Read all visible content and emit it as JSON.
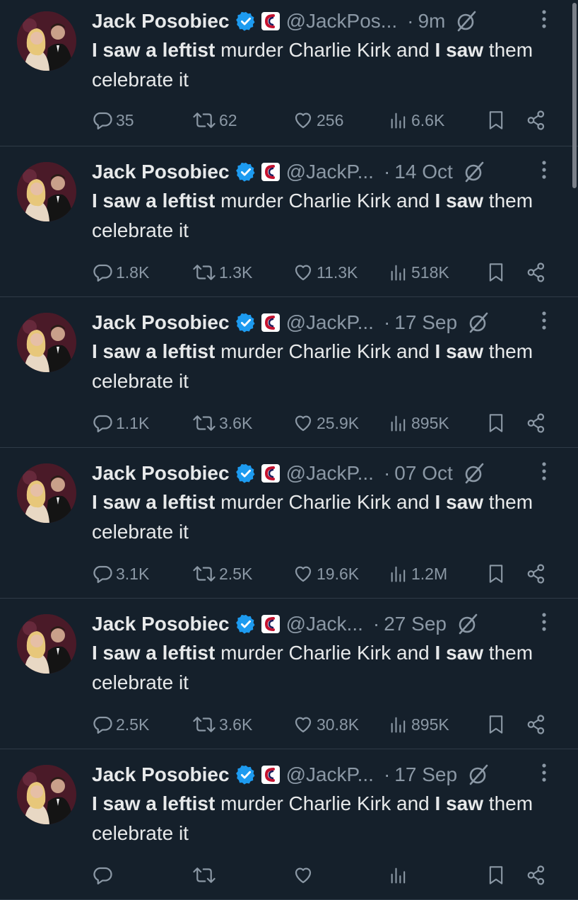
{
  "author": {
    "name": "Jack Posobiec"
  },
  "tweets": [
    {
      "handle": "@JackPos...",
      "time": "9m",
      "text_bold1": "I saw a leftist",
      "text_mid": " murder Charlie Kirk and ",
      "text_bold2": "I saw",
      "text_end": " them celebrate it",
      "replies": "35",
      "reposts": "62",
      "likes": "256",
      "views": "6.6K"
    },
    {
      "handle": "@JackP...",
      "time": "14 Oct",
      "text_bold1": "I saw a leftist",
      "text_mid": " murder Charlie Kirk and ",
      "text_bold2": "I saw",
      "text_end": " them celebrate it",
      "replies": "1.8K",
      "reposts": "1.3K",
      "likes": "11.3K",
      "views": "518K"
    },
    {
      "handle": "@JackP...",
      "time": "17 Sep",
      "text_bold1": "I saw a leftist",
      "text_mid": " murder Charlie Kirk and ",
      "text_bold2": "I saw",
      "text_end": " them celebrate it",
      "replies": "1.1K",
      "reposts": "3.6K",
      "likes": "25.9K",
      "views": "895K"
    },
    {
      "handle": "@JackP...",
      "time": "07 Oct",
      "text_bold1": "I saw a leftist",
      "text_mid": " murder Charlie Kirk and ",
      "text_bold2": "I saw",
      "text_end": " them celebrate it",
      "replies": "3.1K",
      "reposts": "2.5K",
      "likes": "19.6K",
      "views": "1.2M"
    },
    {
      "handle": "@Jack...",
      "time": "27 Sep",
      "text_bold1": "I saw a leftist",
      "text_mid": " murder Charlie Kirk and ",
      "text_bold2": "I saw",
      "text_end": " them celebrate it",
      "replies": "2.5K",
      "reposts": "3.6K",
      "likes": "30.8K",
      "views": "895K"
    },
    {
      "handle": "@JackP...",
      "time": "17 Sep",
      "text_bold1": "I saw a leftist",
      "text_mid": " murder Charlie Kirk and ",
      "text_bold2": "I saw",
      "text_end": " them celebrate it",
      "replies": "",
      "reposts": "",
      "likes": "",
      "views": ""
    }
  ],
  "ui": {
    "dot": "·",
    "icons": {
      "verified": "verified-badge-icon",
      "affiliate": "affiliate-badge-icon",
      "grok": "grok-icon",
      "more": "more-options-icon",
      "reply": "reply-icon",
      "repost": "repost-icon",
      "like": "like-icon",
      "views": "views-icon",
      "bookmark": "bookmark-icon",
      "share": "share-icon"
    },
    "colors": {
      "background": "#15202b",
      "text": "#e7e9ea",
      "secondary": "#8b98a5",
      "verified": "#1d9bf0",
      "divider": "#2f3b47"
    }
  }
}
